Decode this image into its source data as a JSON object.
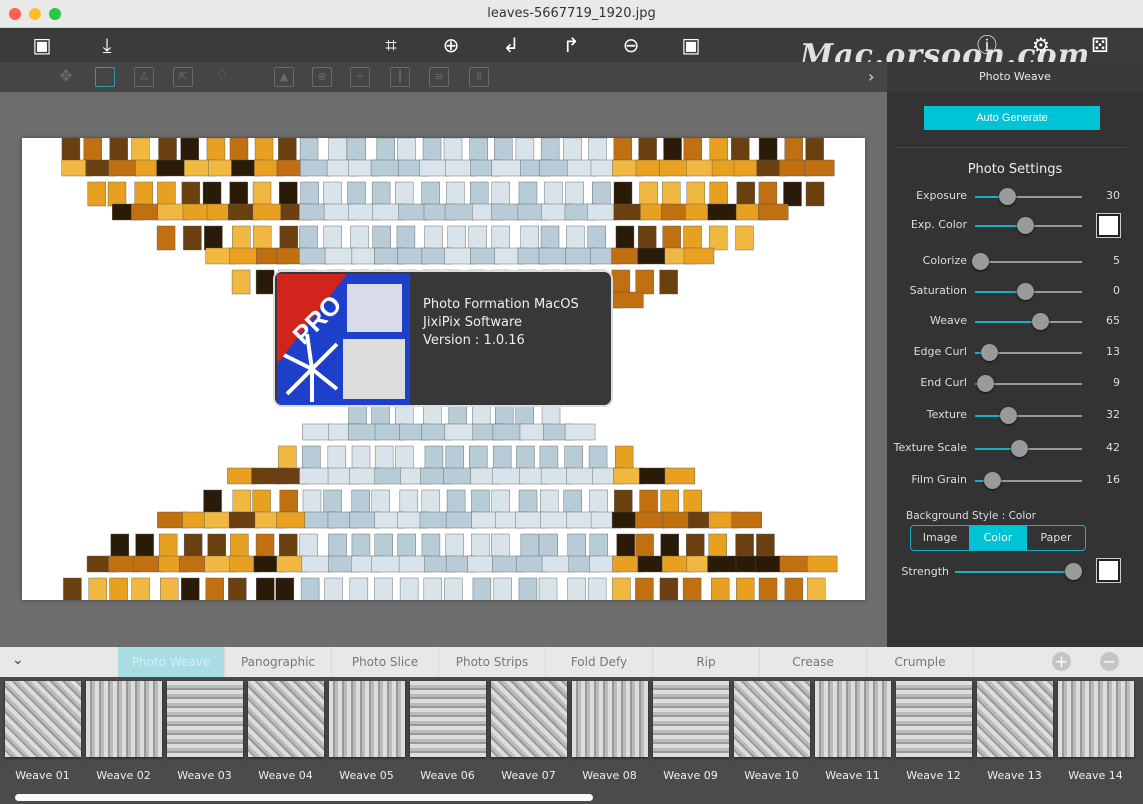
{
  "window": {
    "title": "leaves-5667719_1920.jpg",
    "watermark": "Mac.orsoon.com"
  },
  "toolbar": {
    "left": [
      {
        "icon": "open-image-icon"
      },
      {
        "icon": "save-download-icon"
      }
    ],
    "center": [
      {
        "icon": "crop-icon"
      },
      {
        "icon": "zoom-in-icon"
      },
      {
        "icon": "undo-icon"
      },
      {
        "icon": "redo-icon"
      },
      {
        "icon": "zoom-out-icon"
      },
      {
        "icon": "fit-image-icon"
      }
    ],
    "right": [
      {
        "icon": "info-icon"
      },
      {
        "icon": "settings-icon"
      },
      {
        "icon": "dice-random-icon"
      }
    ]
  },
  "subtoolbar": {
    "icons": [
      "move-icon",
      "select-rect-icon",
      "portrait-icon",
      "export-icon",
      "lightbulb-icon",
      "image-layer-icon",
      "remove-icon",
      "add-row-icon",
      "add-column-icon",
      "rows-icon",
      "columns-icon"
    ]
  },
  "panel": {
    "header": "Photo Weave",
    "auto_generate": "Auto Generate",
    "section_title": "Photo Settings",
    "sliders": [
      {
        "label": "Exposure",
        "value": "30",
        "level": 0.3
      },
      {
        "label": "Exp. Color",
        "value": "",
        "level": 0.47,
        "swatch": "#ffffff"
      },
      {
        "label": "Colorize",
        "value": "5",
        "level": 0.05
      },
      {
        "label": "Saturation",
        "value": "0",
        "level": 0.47
      },
      {
        "label": "Weave",
        "value": "65",
        "level": 0.61
      },
      {
        "label": "Edge Curl",
        "value": "13",
        "level": 0.13
      },
      {
        "label": "End Curl",
        "value": "9",
        "level": 0.09
      },
      {
        "label": "Texture",
        "value": "32",
        "level": 0.31
      },
      {
        "label": "Texture Scale",
        "value": "42",
        "level": 0.41
      },
      {
        "label": "Film Grain",
        "value": "16",
        "level": 0.16
      }
    ],
    "background_style_label": "Background Style : Color",
    "background_options": [
      "Image",
      "Color",
      "Paper"
    ],
    "background_selected": "Color",
    "strength": {
      "label": "Strength",
      "level": 0.97,
      "swatch": "#ffffff"
    }
  },
  "about": {
    "badge": "PRO",
    "line1": "Photo Formation MacOS",
    "line2": "JixiPix Software",
    "line3": "Version : 1.0.16"
  },
  "tabs": {
    "items": [
      "Photo Weave",
      "Panographic",
      "Photo Slice",
      "Photo Strips",
      "Fold Defy",
      "Rip",
      "Crease",
      "Crumple"
    ],
    "active": "Photo Weave",
    "add": "+",
    "remove": "−"
  },
  "presets": [
    "Weave 01",
    "Weave 02",
    "Weave 03",
    "Weave 04",
    "Weave 05",
    "Weave 06",
    "Weave 07",
    "Weave 08",
    "Weave 09",
    "Weave 10",
    "Weave 11",
    "Weave 12",
    "Weave 13",
    "Weave 14"
  ],
  "colors": {
    "accent": "#00c3d6",
    "panel": "#333333"
  }
}
